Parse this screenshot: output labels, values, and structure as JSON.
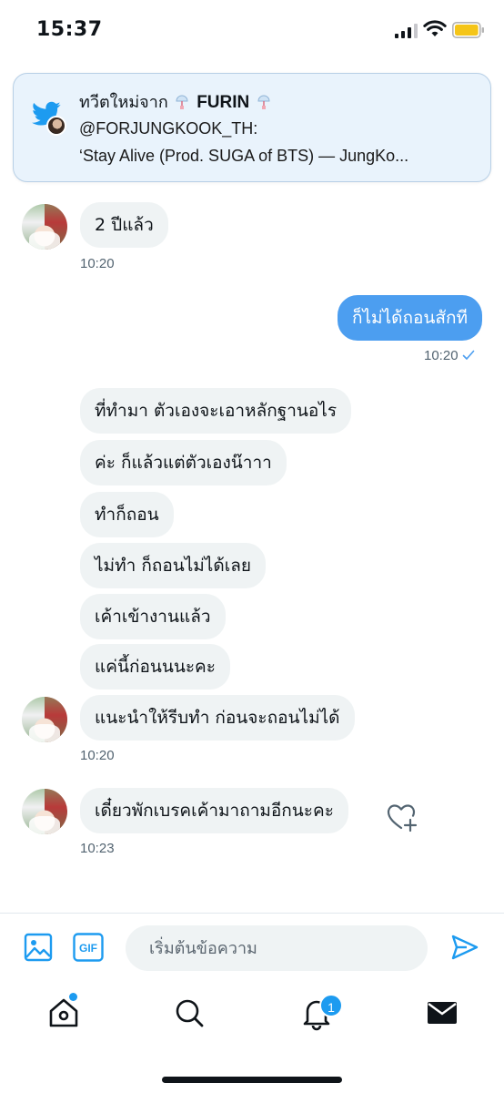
{
  "status_bar": {
    "time": "15:37"
  },
  "notification": {
    "prefix": "ทวีตใหม่จาก ",
    "sender_name": "FURIN",
    "handle_line": "@FORJUNGKOOK_TH:",
    "preview": "‘Stay Alive (Prod. SUGA of BTS) — JungKo..."
  },
  "conversation": {
    "messages": [
      {
        "from": "them",
        "text": "2 ปีแล้ว"
      },
      {
        "from": "them_time",
        "text": "10:20"
      },
      {
        "from": "me",
        "text": "ก็ไม่ได้ถอนสักที"
      },
      {
        "from": "me_time",
        "text": "10:20"
      },
      {
        "from": "them",
        "text": "ที่ทำมา ตัวเองจะเอาหลักฐานอไร"
      },
      {
        "from": "them",
        "text": "ค่ะ ก็แล้วแต่ตัวเองน๊าาา"
      },
      {
        "from": "them",
        "text": "ทำก็ถอน"
      },
      {
        "from": "them",
        "text": "ไม่ทำ ก็ถอนไม่ได้เลย"
      },
      {
        "from": "them",
        "text": "เค้าเข้างานแล้ว"
      },
      {
        "from": "them",
        "text": "แค่นี้ก่อนนนะคะ"
      },
      {
        "from": "them",
        "text": "แนะนำให้รีบทำ ก่อนจะถอนไม่ได้"
      },
      {
        "from": "them_time",
        "text": "10:20"
      },
      {
        "from": "them",
        "text": "เดี๋ยวพักเบรคเค้ามาถามอีกนะคะ"
      },
      {
        "from": "them_time",
        "text": "10:23"
      }
    ]
  },
  "composer": {
    "placeholder": "เริ่มต้นข้อความ",
    "gif_label": "GIF"
  },
  "tab_bar": {
    "notifications_badge": "1"
  },
  "colors": {
    "accent": "#1d9bf0",
    "outgoing_bubble": "#4c9ef0",
    "incoming_bubble": "#eff3f4"
  }
}
